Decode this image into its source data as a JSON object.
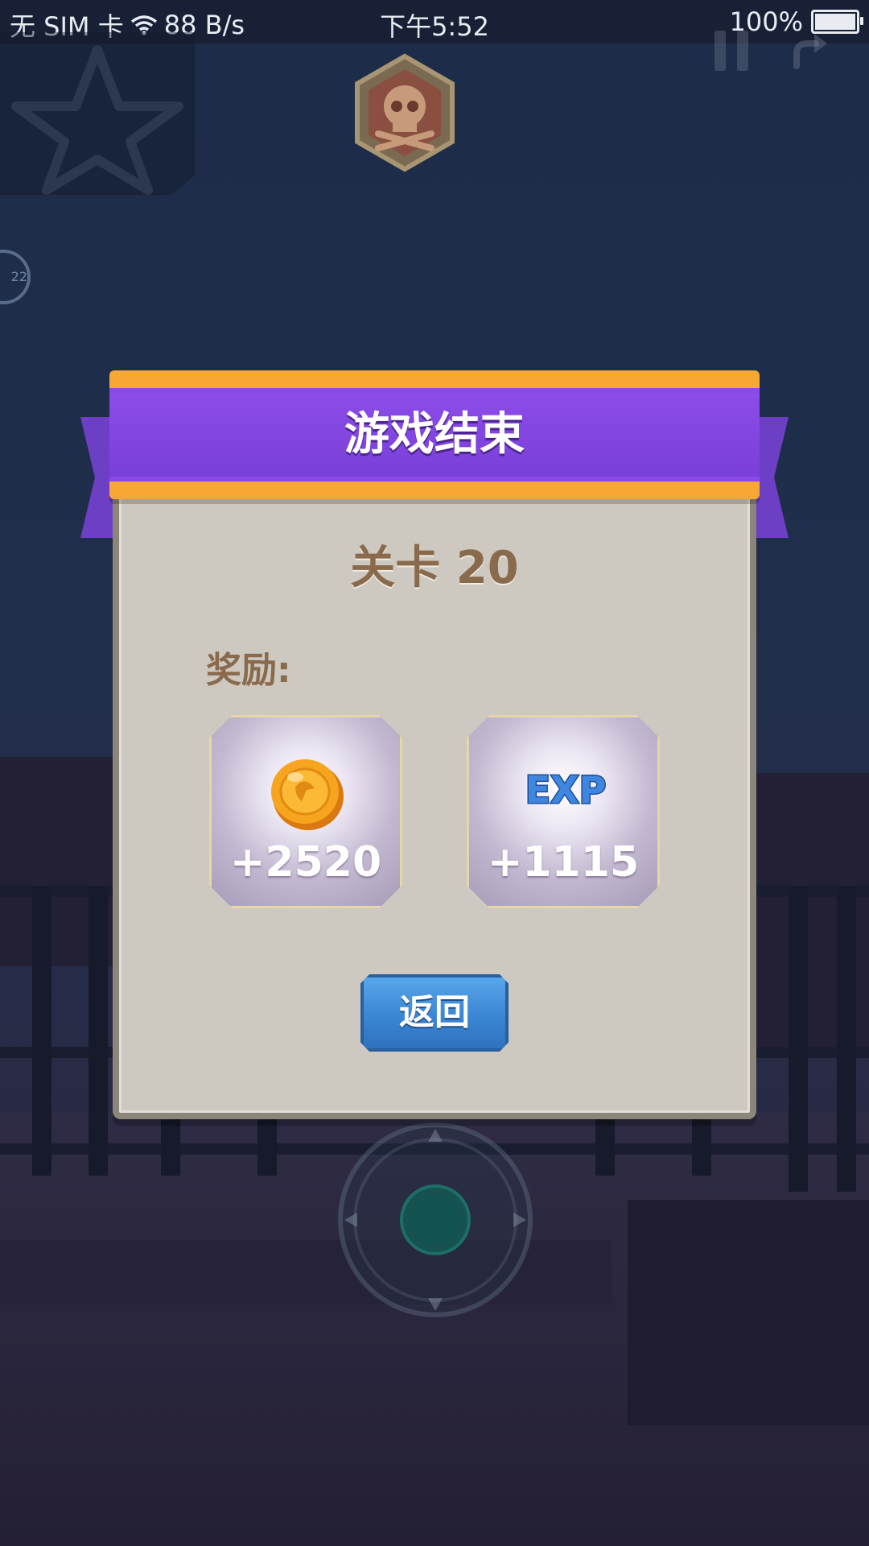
{
  "status_bar": {
    "carrier": "无 SIM 卡",
    "network_speed": "88 B/s",
    "time": "下午5:52",
    "battery": "100%"
  },
  "hud": {
    "side_ring_text": "22"
  },
  "dialog": {
    "title": "游戏结束",
    "level": "关卡 20",
    "rewards_label": "奖励:",
    "rewards": [
      {
        "icon": "coin-icon",
        "amount": "+2520"
      },
      {
        "icon": "exp-icon",
        "label": "EXP",
        "amount": "+1115"
      }
    ],
    "back_button": "返回"
  },
  "colors": {
    "ribbon_purple": "#8a49e6",
    "ribbon_gold": "#f7a733",
    "panel": "#cdc9c1",
    "text_brown": "#8a6a4c",
    "button_blue": "#3a86d3"
  }
}
